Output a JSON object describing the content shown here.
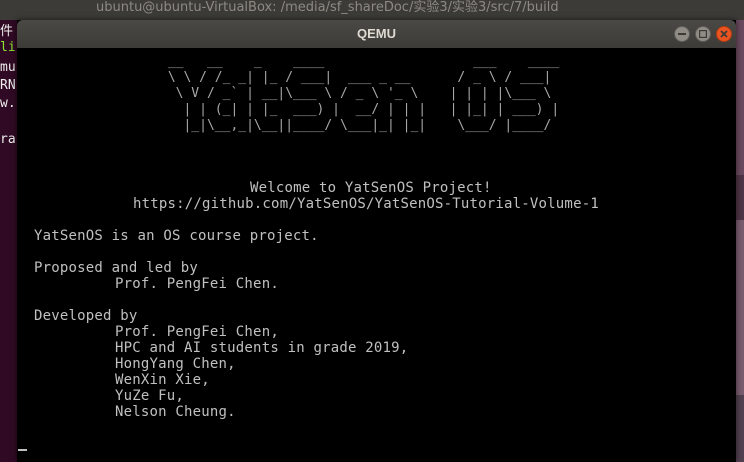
{
  "background": {
    "topbar_text": "ubuntu@ubuntu-VirtualBox: /media/sf_shareDoc/实验3/实验3/src/7/build",
    "terminal_lines": [
      "件",
      "li",
      "mu",
      "RN",
      "w.",
      "",
      "ra"
    ]
  },
  "window": {
    "title": "QEMU",
    "controls": {
      "minimize": "minimize",
      "maximize": "maximize",
      "close": "close"
    }
  },
  "screen": {
    "logo_lines": [
      " __   __    _    ____                   ___    ____  ",
      " \\ \\ / /_ _| |_ / ___|  ___ _ __      / _ \\ / ___| ",
      "  \\ V / _` | __|\\___ \\ / _ \\ '_ \\    | | | |\\___ \\ ",
      "   | | (_| | |_  ___) |  __/ | | |   | |_| | ___) |",
      "   |_|\\__,_|\\__||____/ \\___|_| |_|    \\___/ |____/ "
    ],
    "welcome": "Welcome to YatSenOS Project!",
    "url": "https://github.com/YatSenOS/YatSenOS-Tutorial-Volume-1",
    "description": "YatSenOS is an OS course project.",
    "proposed_heading": "Proposed and led by",
    "proposed_by": "Prof. PengFei Chen.",
    "developed_heading": "Developed by",
    "developers": [
      "Prof. PengFei Chen,",
      "HPC and AI students in grade 2019,",
      "HongYang Chen,",
      "WenXin Xie,",
      "YuZe Fu,",
      "Nelson Cheung."
    ],
    "cursor": "_"
  }
}
